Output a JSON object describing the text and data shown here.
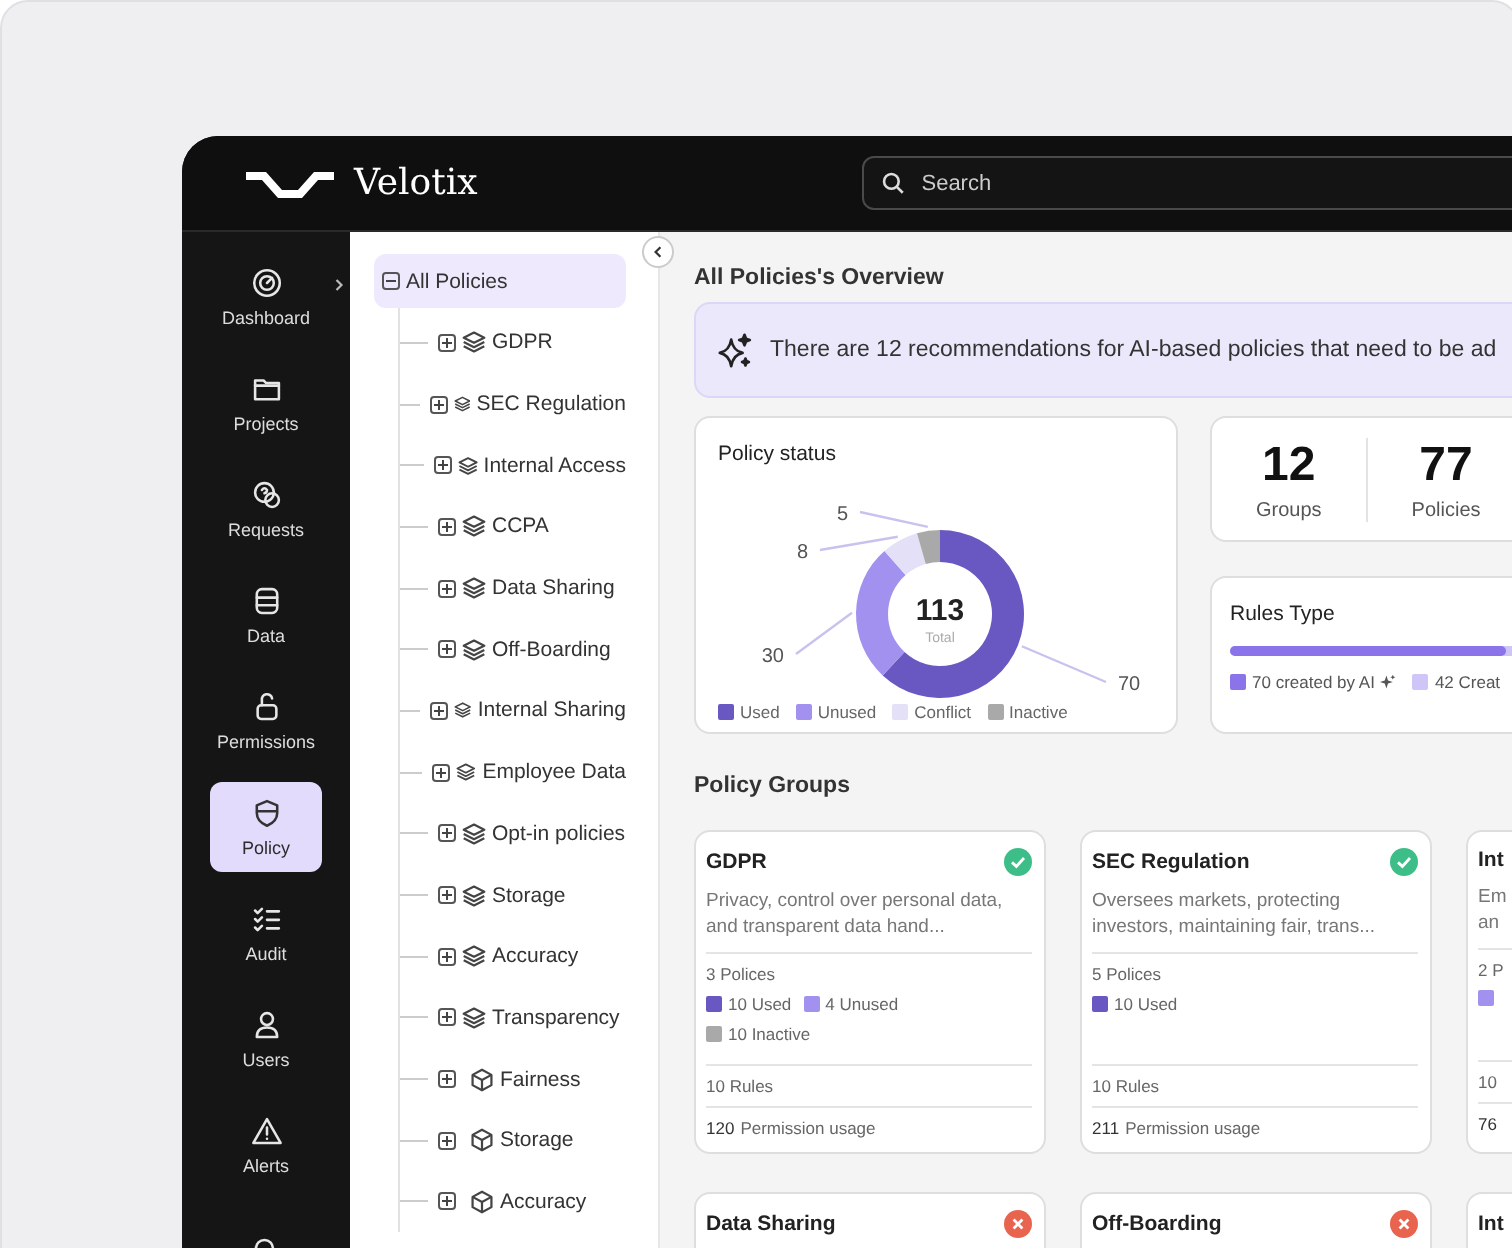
{
  "header": {
    "brand": "Velotix",
    "search": {
      "placeholder": "Search"
    }
  },
  "sidebar": {
    "items": [
      {
        "label": "Dashboard",
        "kind": "gauge",
        "selected": false
      },
      {
        "label": "Projects",
        "kind": "folder",
        "selected": false
      },
      {
        "label": "Requests",
        "kind": "question",
        "selected": false
      },
      {
        "label": "Data",
        "kind": "database",
        "selected": false
      },
      {
        "label": "Permissions",
        "kind": "lock",
        "selected": false
      },
      {
        "label": "Policy",
        "kind": "shield",
        "selected": true
      },
      {
        "label": "Audit",
        "kind": "checklist",
        "selected": false
      },
      {
        "label": "Users",
        "kind": "user",
        "selected": false
      },
      {
        "label": "Alerts",
        "kind": "alert",
        "selected": false
      },
      {
        "kind": "search",
        "selected": false
      }
    ]
  },
  "tree": {
    "label": "All Policies",
    "selected": true,
    "expanded": true,
    "children": [
      {
        "label": "GDPR",
        "kind": "group",
        "expanded": false
      },
      {
        "label": "SEC Regulation",
        "kind": "group",
        "expanded": false
      },
      {
        "label": "Internal Access",
        "kind": "group",
        "expanded": false
      },
      {
        "label": "CCPA",
        "kind": "group",
        "expanded": false
      },
      {
        "label": "Data Sharing",
        "kind": "group",
        "expanded": false
      },
      {
        "label": "Off-Boarding",
        "kind": "group",
        "expanded": false
      },
      {
        "label": "Internal Sharing",
        "kind": "group",
        "expanded": false
      },
      {
        "label": "Employee Data",
        "kind": "group",
        "expanded": false
      },
      {
        "label": "Opt-in policies",
        "kind": "group",
        "expanded": false
      },
      {
        "label": "Storage",
        "kind": "group",
        "expanded": false
      },
      {
        "label": "Accuracy",
        "kind": "group",
        "expanded": false
      },
      {
        "label": "Transparency",
        "kind": "group",
        "expanded": false
      },
      {
        "label": "Fairness",
        "kind": "policy",
        "expanded": false
      },
      {
        "label": "Storage",
        "kind": "policy",
        "expanded": false
      },
      {
        "label": "Accuracy",
        "kind": "policy",
        "expanded": false
      }
    ]
  },
  "overview": {
    "title": "All Policies's Overview",
    "banner": "There are 12 recommendations for AI-based policies that need to be ad",
    "policy_status": {
      "title": "Policy status",
      "total": "113",
      "total_label": "Total",
      "chart_data": {
        "type": "donut",
        "categories": [
          "Used",
          "Unused",
          "Conflict",
          "Inactive"
        ],
        "values": [
          70,
          30,
          8,
          5
        ],
        "colors": [
          "#6a58c2",
          "#a391ef",
          "#e4e0f8",
          "#a9a9a9"
        ],
        "data_labels": true,
        "legend": true
      }
    },
    "stats": [
      {
        "value": "12",
        "label": "Groups"
      },
      {
        "value": "77",
        "label": "Policies"
      }
    ],
    "rules_type": {
      "title": "Rules Type",
      "level": 0.625,
      "legend": [
        {
          "label": "70 created by AI",
          "color": "#8b73ea",
          "ai": true
        },
        {
          "label": "42 Creat",
          "color": "#cfc6f7",
          "ai": false
        }
      ]
    }
  },
  "policy_groups": {
    "title": "Policy Groups",
    "cards": [
      {
        "title": "GDPR",
        "kind": "ok",
        "description": "Privacy, control over personal data,\nand transparent data hand...",
        "policies": "3 Polices",
        "legend": [
          {
            "kind": "used",
            "label": "10 Used"
          },
          {
            "kind": "unused",
            "label": "4 Unused"
          },
          {
            "kind": "inactive",
            "label": "10 Inactive"
          }
        ],
        "rules": "10 Rules",
        "permission_value": "120",
        "permission_label": "Permission usage"
      },
      {
        "title": "SEC Regulation",
        "kind": "ok",
        "description": "Oversees markets, protecting\ninvestors, maintaining fair, trans...",
        "policies": "5 Polices",
        "legend": [
          {
            "kind": "used",
            "label": "10 Used"
          }
        ],
        "rules": "10 Rules",
        "permission_value": "211",
        "permission_label": "Permission usage"
      },
      {
        "title": "Int",
        "kind": "plain",
        "description": "Em\nan",
        "policies": "2 P",
        "legend": [
          {
            "kind": "unused"
          }
        ],
        "rules": "10",
        "permission_value": "76"
      },
      {
        "title": "Data Sharing",
        "kind": "error"
      },
      {
        "title": "Off-Boarding",
        "kind": "error"
      },
      {
        "title": "Int",
        "kind": "plain"
      }
    ]
  }
}
